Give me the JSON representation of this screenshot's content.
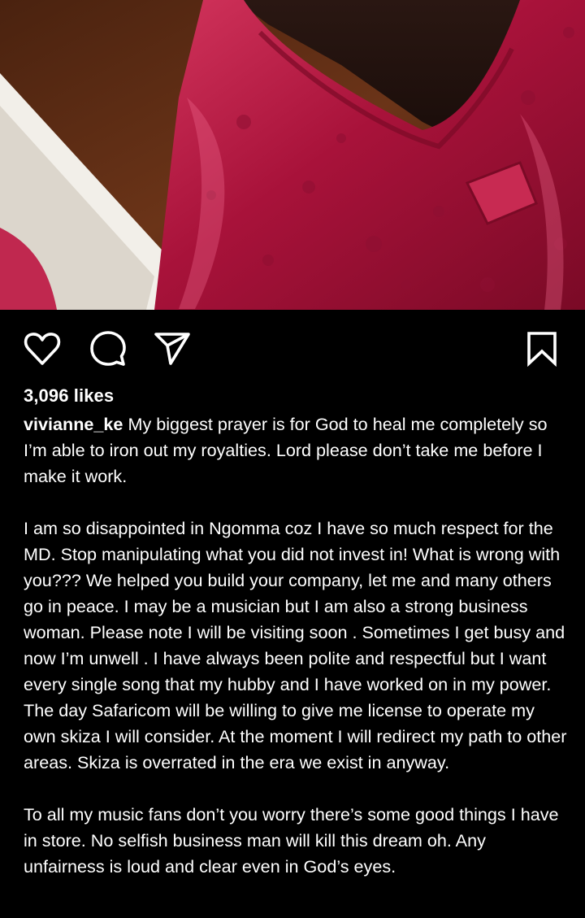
{
  "post": {
    "likes": "3,096 likes",
    "username": "vivianne_ke",
    "caption_paragraphs": [
      "My biggest prayer is for God to heal me completely so I’m able to iron out my royalties. Lord please don’t take me before I make it work.",
      "I am so disappointed in Ngomma coz I have so much respect for the MD. Stop manipulating what you did not invest in! What is wrong with you??? We helped you build your company, let me and many others go in peace. I may be a musician but I am also a strong business woman. Please note I will be visiting soon . Sometimes I get busy and now I’m unwell . I have always been polite and respectful but I want every single song that my hubby and I have worked on in my power. The day Safaricom will be willing to give me license to operate my own skiza I will consider. At the moment I will redirect my path to other areas. Skiza is overrated in the era we exist in anyway.",
      "To all my music fans don’t you worry there’s some good things I have in store. No selfish business man will kill this dream oh. Any unfairness is loud and clear even in God’s eyes."
    ]
  },
  "icons": {
    "like": "heart-outline-icon",
    "comment": "speech-bubble-icon",
    "share": "paper-plane-icon",
    "save": "bookmark-outline-icon"
  },
  "colors": {
    "background": "#000000",
    "text": "#ffffff",
    "garment": "#b0153a"
  }
}
